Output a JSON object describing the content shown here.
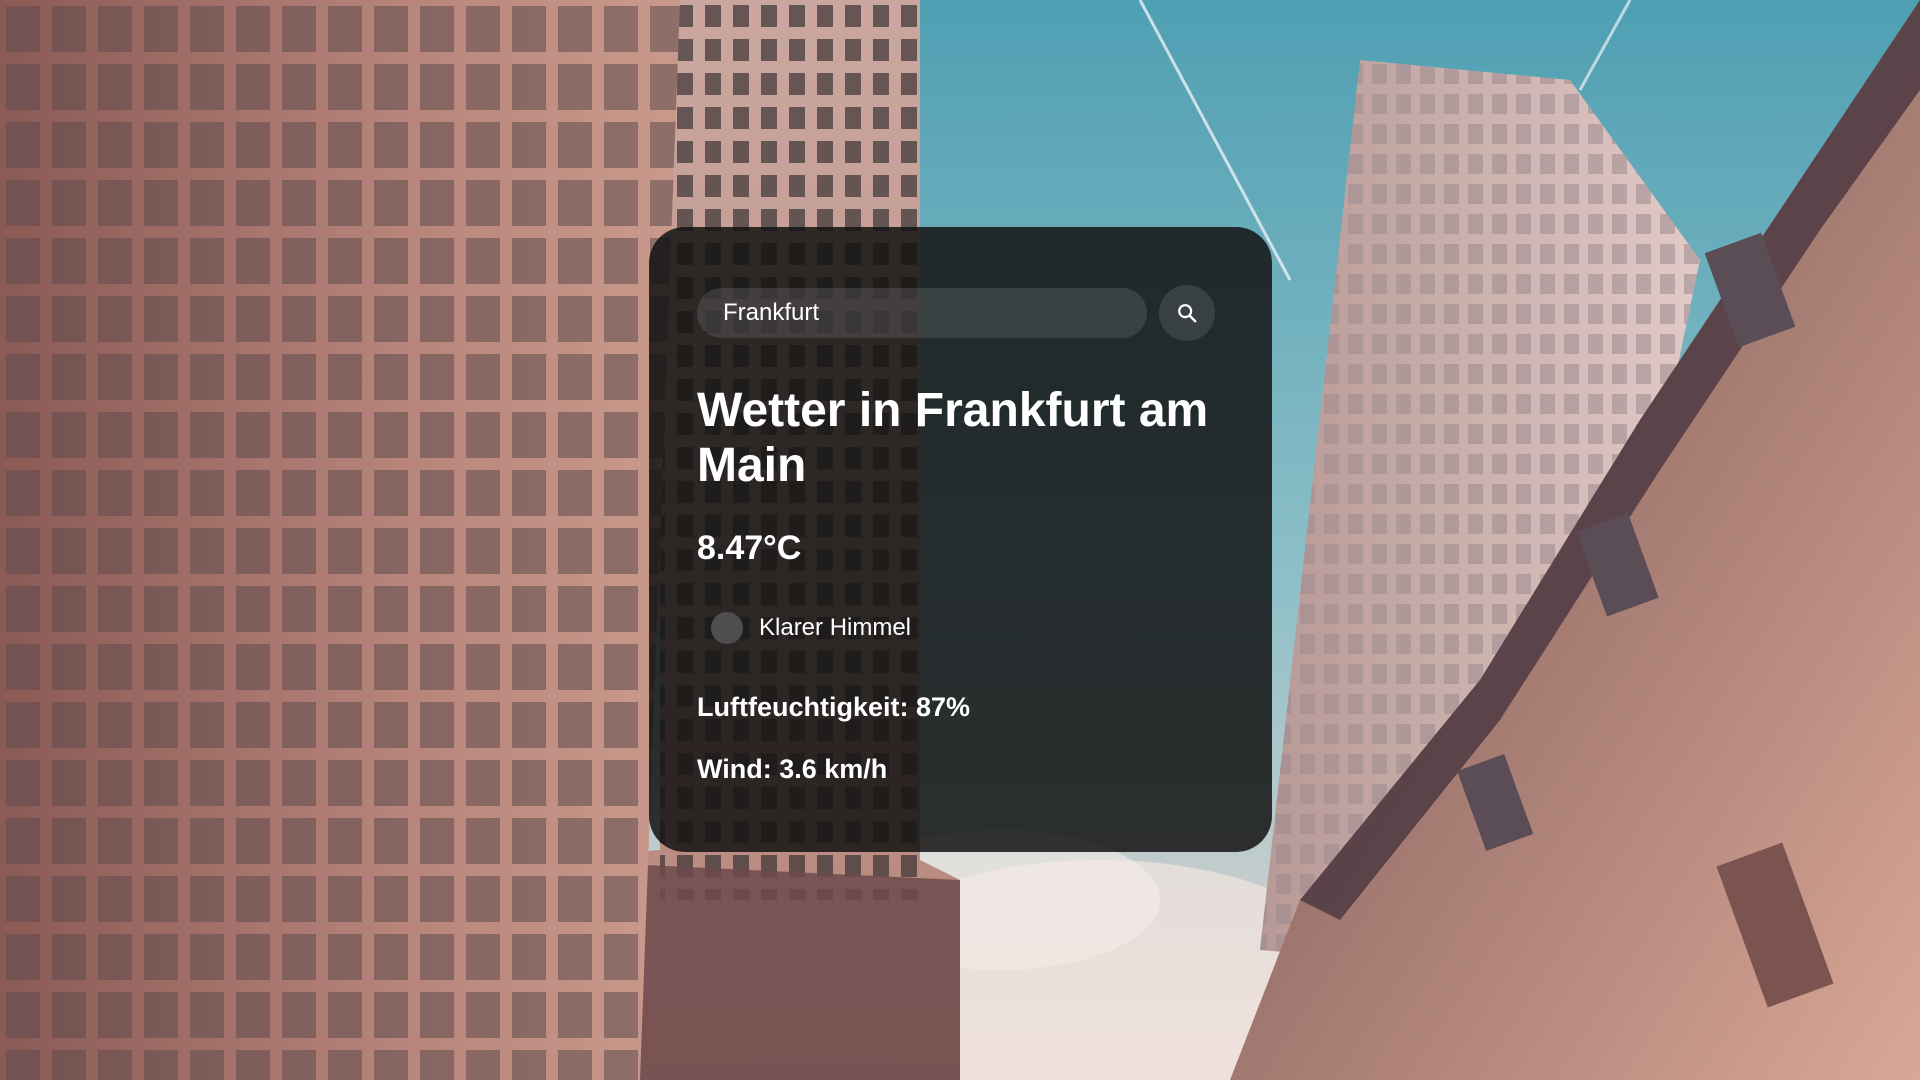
{
  "search": {
    "value": "Frankfurt",
    "button_icon": "search-icon"
  },
  "weather": {
    "heading": "Wetter in Frankfurt am Main",
    "temperature": "8.47°C",
    "description": "Klarer Himmel",
    "humidity": "Luftfeuchtigkeit: 87%",
    "wind": "Wind: 3.6 km/h"
  },
  "colors": {
    "card_background": "#141414",
    "text": "#ffffff",
    "sky": "#5aa3b4"
  }
}
